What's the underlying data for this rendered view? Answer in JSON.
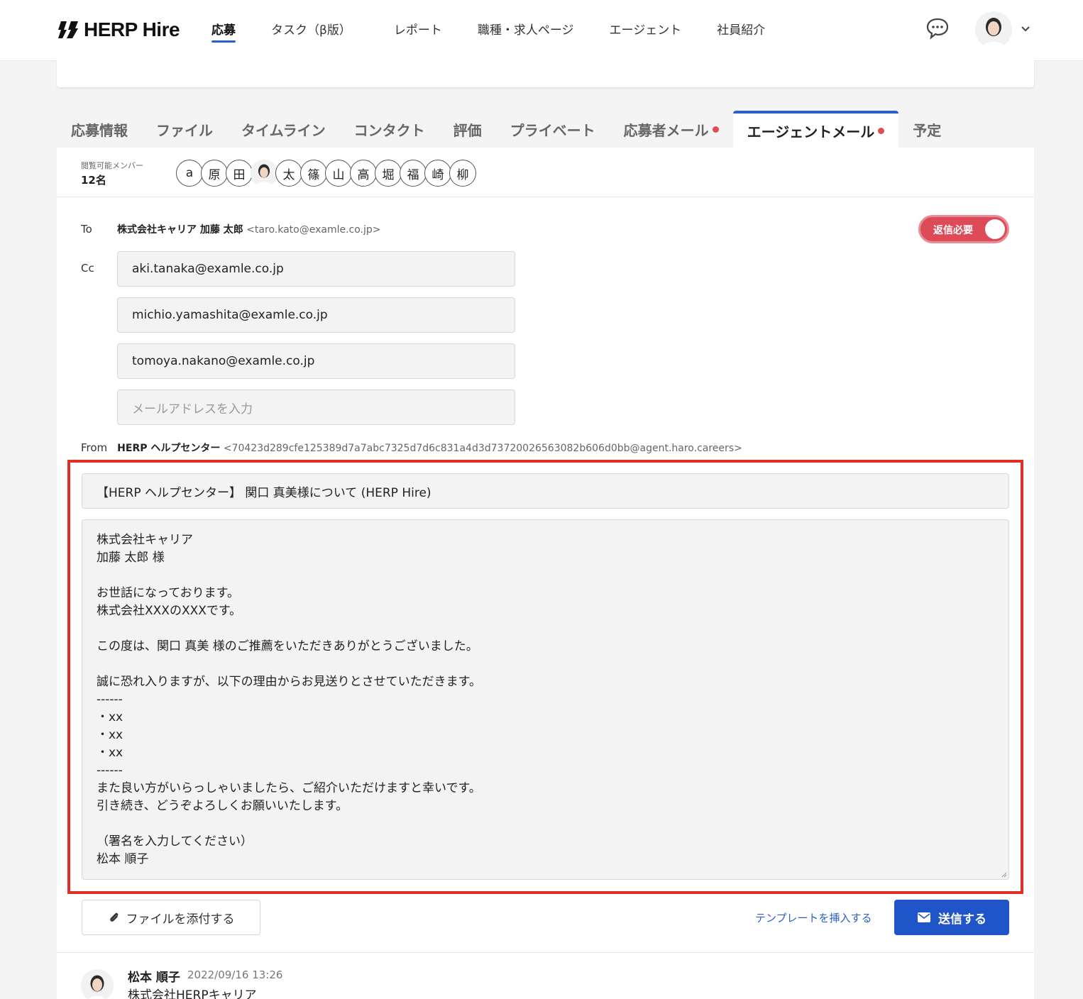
{
  "brand": {
    "name": "HERP Hire"
  },
  "nav": {
    "items": [
      {
        "label": "応募",
        "active": true
      },
      {
        "label": "タスク（β版）"
      },
      {
        "label": "レポート"
      },
      {
        "label": "職種・求人ページ"
      },
      {
        "label": "エージェント"
      },
      {
        "label": "社員紹介"
      }
    ]
  },
  "tabs": [
    {
      "label": "応募情報"
    },
    {
      "label": "ファイル"
    },
    {
      "label": "タイムライン"
    },
    {
      "label": "コンタクト"
    },
    {
      "label": "評価"
    },
    {
      "label": "プライベート"
    },
    {
      "label": "応募者メール",
      "dot": true
    },
    {
      "label": "エージェントメール",
      "dot": true,
      "active": true
    },
    {
      "label": "予定"
    }
  ],
  "members": {
    "label": "閲覧可能メンバー",
    "count": "12名",
    "list": [
      "a",
      "原",
      "田",
      "",
      "太",
      "篠",
      "山",
      "高",
      "堀",
      "福",
      "崎",
      "柳"
    ]
  },
  "mail": {
    "to_label": "To",
    "to_name": "株式会社キャリア 加藤 太郎",
    "to_addr": "<taro.kato@examle.co.jp>",
    "reply_required": "返信必要",
    "cc_label": "Cc",
    "cc": [
      "aki.tanaka@examle.co.jp",
      "michio.yamashita@examle.co.jp",
      "tomoya.nakano@examle.co.jp"
    ],
    "cc_placeholder": "メールアドレスを入力",
    "from_label": "From",
    "from_name": "HERP ヘルプセンター",
    "from_addr": "<70423d289cfe125389d7a7abc7325d7d6c831a4d3d73720026563082b606d0bb@agent.haro.careers>",
    "subject": "【HERP ヘルプセンター】 関口 真美様について (HERP Hire)",
    "body_lines": [
      "株式会社キャリア",
      "加藤 太郎 様",
      "",
      "お世話になっております。",
      "株式会社XXXのXXXです。",
      "",
      "この度は、関口 真美 様のご推薦をいただきありがとうございました。",
      "",
      "誠に恐れ入りますが、以下の理由からお見送りとさせていただきます。",
      "------",
      "・xx",
      "・xx",
      "・xx",
      "------",
      "また良い方がいらっしゃいましたら、ご紹介いただけますと幸いです。",
      "引き続き、どうぞよろしくお願いいたします。",
      "",
      "（署名を入力してください）",
      "松本 順子"
    ],
    "attach_label": "ファイルを添付する",
    "template_label": "テンプレートを挿入する",
    "send_label": "送信する"
  },
  "post": {
    "author": "松本 順子",
    "time": "2022/09/16 13:26",
    "company": "株式会社HERPキャリア"
  },
  "colors": {
    "accent": "#2c5fc8",
    "send": "#1f55c8",
    "toggle": "#dc4b57",
    "highlight": "#e02f27"
  }
}
